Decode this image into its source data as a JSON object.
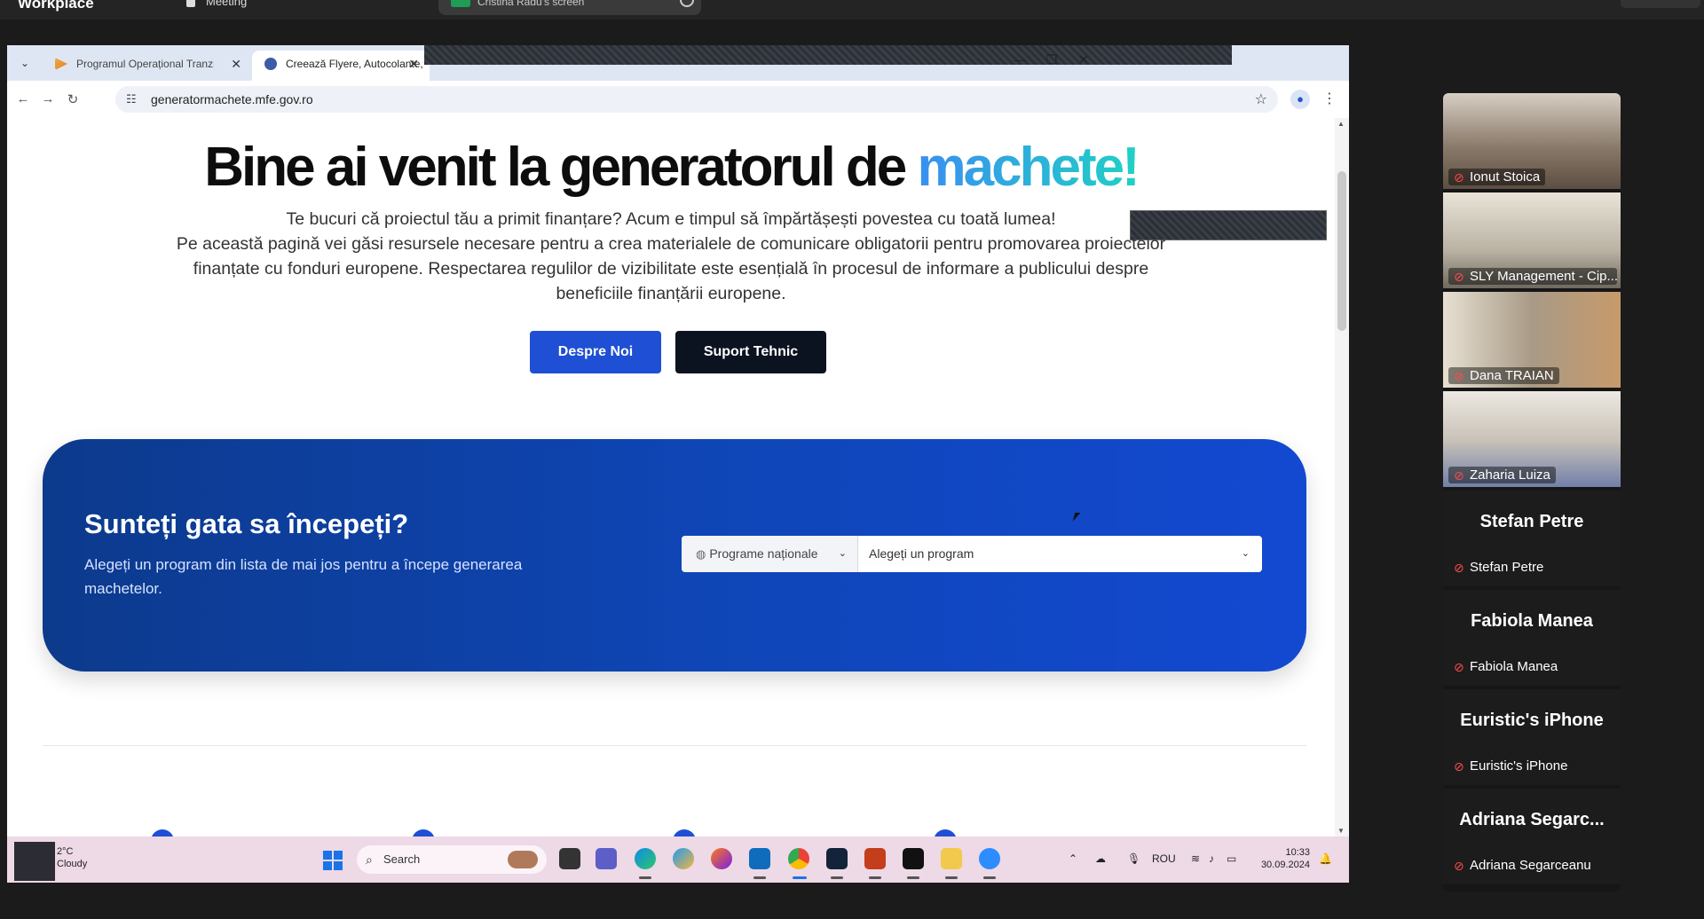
{
  "workplace": {
    "title": "Workplace",
    "meeting_label": "Meeting",
    "share_label": "Cristina Radu's screen"
  },
  "browser": {
    "tabs": [
      {
        "label": "Programul Operațional Tranziție Justă",
        "active": false
      },
      {
        "label": "Creează Flyere, Autocolante, Pa",
        "active": true
      }
    ],
    "url": "generatormachete.mfe.gov.ro"
  },
  "page": {
    "hero_title_main": "Bine ai venit la generatorul de ",
    "hero_title_accent": "machete!",
    "hero_line1": "Te bucuri că proiectul tău a primit finanțare? Acum e timpul să împărtășești povestea cu toată lumea!",
    "hero_line2": "Pe această pagină vei găsi resursele necesare pentru a crea materialele de comunicare obligatorii pentru promovarea proiectelor finanțate cu fonduri europene. Respectarea regulilor de vizibilitate este esențială în procesul de informare a publicului despre beneficiile finanțării europene.",
    "btn_about": "Despre Noi",
    "btn_support": "Suport Tehnic",
    "cta_title": "Sunteți gata sa începeți?",
    "cta_subtitle": "Alegeți un program din lista de mai jos pentru a începe generarea machetelor.",
    "program_type": "Programe naționale",
    "program_placeholder": "Alegeți un program"
  },
  "taskbar": {
    "weather_temp": "2°C",
    "weather_desc": "Cloudy",
    "search_label": "Search",
    "lang": "ROU",
    "time": "10:33",
    "date": "30.09.2024"
  },
  "participants": [
    {
      "name": "Ionut Stoica",
      "video": true,
      "color": "#8a7a6a"
    },
    {
      "name": "SLY Management - Cip...",
      "video": true,
      "color": "#b9b2a3"
    },
    {
      "name": "Dana TRAIAN",
      "video": true,
      "color": "#a89a86"
    },
    {
      "name": "Zaharia Luiza",
      "video": true,
      "color": "#c9c2b8"
    },
    {
      "name": "Stefan Petre",
      "display": "Stefan Petre",
      "video": false
    },
    {
      "name": "Fabiola Manea",
      "display": "Fabiola Manea",
      "video": false
    },
    {
      "name": "Euristic's iPhone",
      "display": "Euristic's iPhone",
      "video": false
    },
    {
      "name": "Adriana Segarceanu",
      "display": "Adriana Segarc...",
      "video": false
    }
  ]
}
